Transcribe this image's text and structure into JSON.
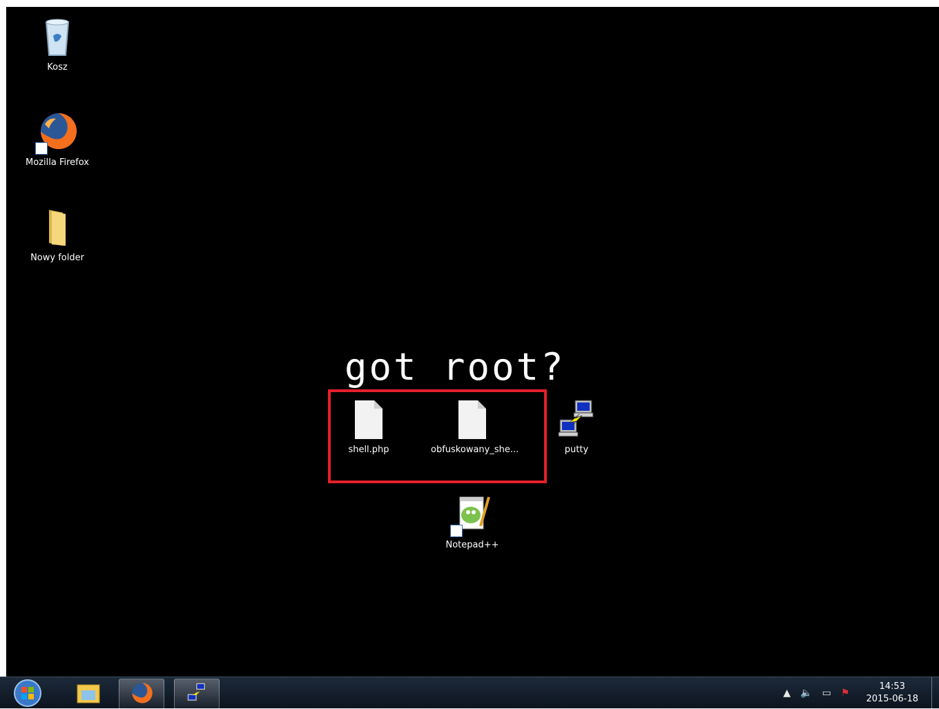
{
  "wallpaper": {
    "text": "got root?"
  },
  "icons": {
    "recycle_bin": {
      "label": "Kosz"
    },
    "firefox": {
      "label": "Mozilla Firefox"
    },
    "new_folder": {
      "label": "Nowy folder"
    },
    "shell_php": {
      "label": "shell.php"
    },
    "obfuscated_shell": {
      "label": "obfuskowany_she..."
    },
    "putty": {
      "label": "putty"
    },
    "notepadpp": {
      "label": "Notepad++"
    }
  },
  "taskbar": {
    "items": [
      "start-orb-icon",
      "explorer-icon",
      "firefox-icon",
      "putty-icon"
    ],
    "clock": {
      "time": "14:53",
      "date": "2015-06-18"
    }
  },
  "colors": {
    "highlight": "#e4202a",
    "desktop_bg": "#000000"
  }
}
